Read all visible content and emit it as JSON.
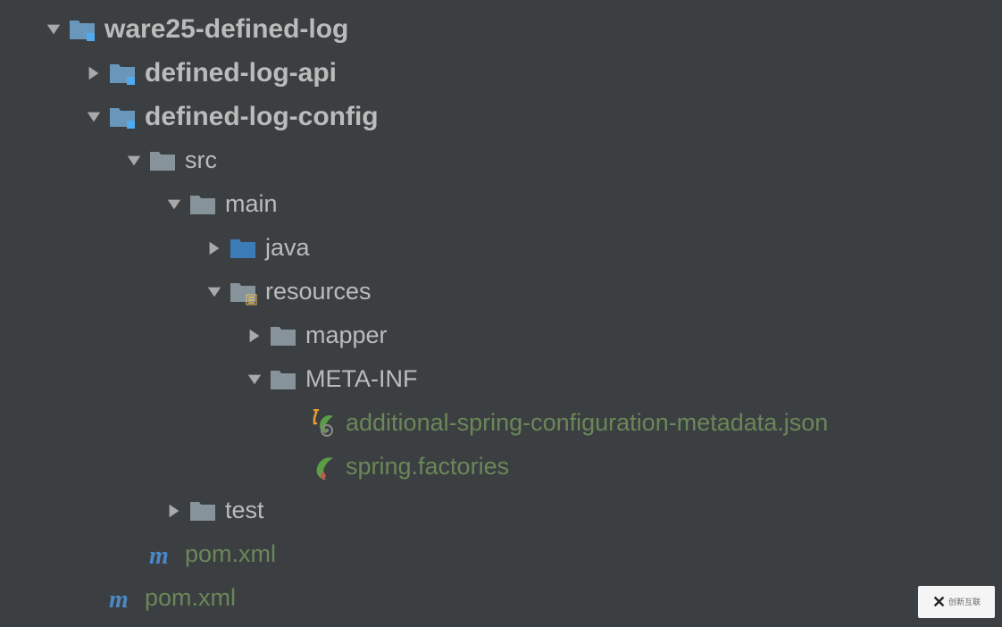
{
  "tree": {
    "root": {
      "label": "ware25-defined-log",
      "expanded": true
    },
    "defined_log_api": {
      "label": "defined-log-api",
      "expanded": false
    },
    "defined_log_config": {
      "label": "defined-log-config",
      "expanded": true
    },
    "src": {
      "label": "src",
      "expanded": true
    },
    "main": {
      "label": "main",
      "expanded": true
    },
    "java": {
      "label": "java",
      "expanded": false
    },
    "resources": {
      "label": "resources",
      "expanded": true
    },
    "mapper": {
      "label": "mapper",
      "expanded": false
    },
    "meta_inf": {
      "label": "META-INF",
      "expanded": true
    },
    "metadata_json": {
      "label": "additional-spring-configuration-metadata.json"
    },
    "spring_factories": {
      "label": "spring.factories"
    },
    "test": {
      "label": "test",
      "expanded": false
    },
    "pom_child": {
      "label": "pom.xml"
    },
    "pom_root": {
      "label": "pom.xml"
    }
  },
  "watermark": {
    "brand": "创新互联"
  }
}
